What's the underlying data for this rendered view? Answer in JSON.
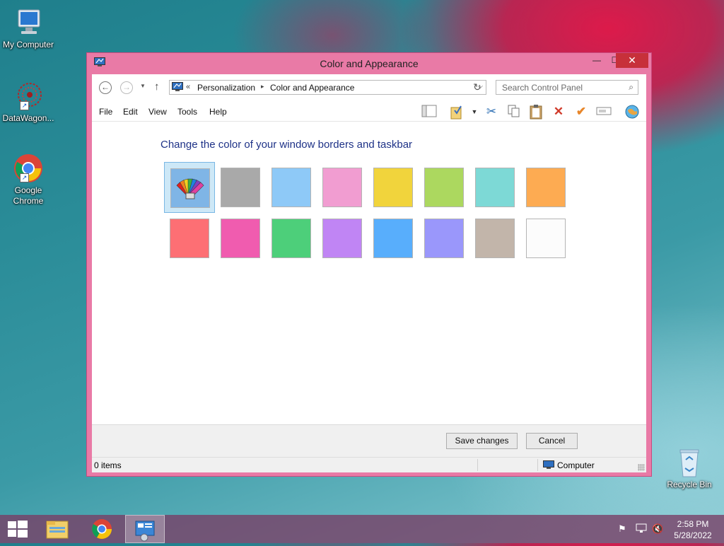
{
  "desktop": {
    "icons": [
      {
        "label": "My Computer"
      },
      {
        "label": "DataWagon..."
      },
      {
        "label": "Google Chrome"
      },
      {
        "label": "Recycle Bin"
      }
    ]
  },
  "window": {
    "title": "Color and Appearance",
    "controls": {
      "minimize": "—",
      "maximize": "☐",
      "close": "✕"
    },
    "address": {
      "chevron": "«",
      "crumbs": [
        "Personalization",
        "Color and Appearance"
      ],
      "separator": "▸"
    },
    "search": {
      "placeholder": "Search Control Panel"
    },
    "menu": [
      "File",
      "Edit",
      "View",
      "Tools",
      "Help"
    ],
    "toolbar_icons": [
      "layout-icon",
      "folder-check-icon",
      "dropdown-icon",
      "cut-icon",
      "copy-icon",
      "paste-icon",
      "delete-icon",
      "checkmark-icon",
      "rename-icon",
      "globe-icon"
    ],
    "heading": "Change the color of your window borders and taskbar",
    "swatches": [
      {
        "name": "automatic",
        "color": "#7fb5e6",
        "selected": true
      },
      {
        "name": "gray",
        "color": "#a9a9a9"
      },
      {
        "name": "light-blue",
        "color": "#8ec9f7"
      },
      {
        "name": "pink",
        "color": "#f19dd1"
      },
      {
        "name": "yellow",
        "color": "#f1d43c"
      },
      {
        "name": "lime",
        "color": "#acd85f"
      },
      {
        "name": "teal",
        "color": "#7dd9d6"
      },
      {
        "name": "orange",
        "color": "#fdab52"
      },
      {
        "name": "red",
        "color": "#fd6f74"
      },
      {
        "name": "magenta",
        "color": "#f05caf"
      },
      {
        "name": "green",
        "color": "#4dcf7a"
      },
      {
        "name": "purple",
        "color": "#c085f4"
      },
      {
        "name": "blue",
        "color": "#58aefc"
      },
      {
        "name": "periwinkle",
        "color": "#9a97fb"
      },
      {
        "name": "taupe",
        "color": "#c2b5aa"
      },
      {
        "name": "white",
        "color": "#fcfcfc"
      }
    ],
    "buttons": {
      "save": "Save changes",
      "cancel": "Cancel"
    },
    "status": {
      "items": "0 items",
      "location": "Computer"
    }
  },
  "taskbar": {
    "clock_time": "2:58 PM",
    "clock_date": "5/28/2022",
    "accent": "#e97aa6"
  }
}
